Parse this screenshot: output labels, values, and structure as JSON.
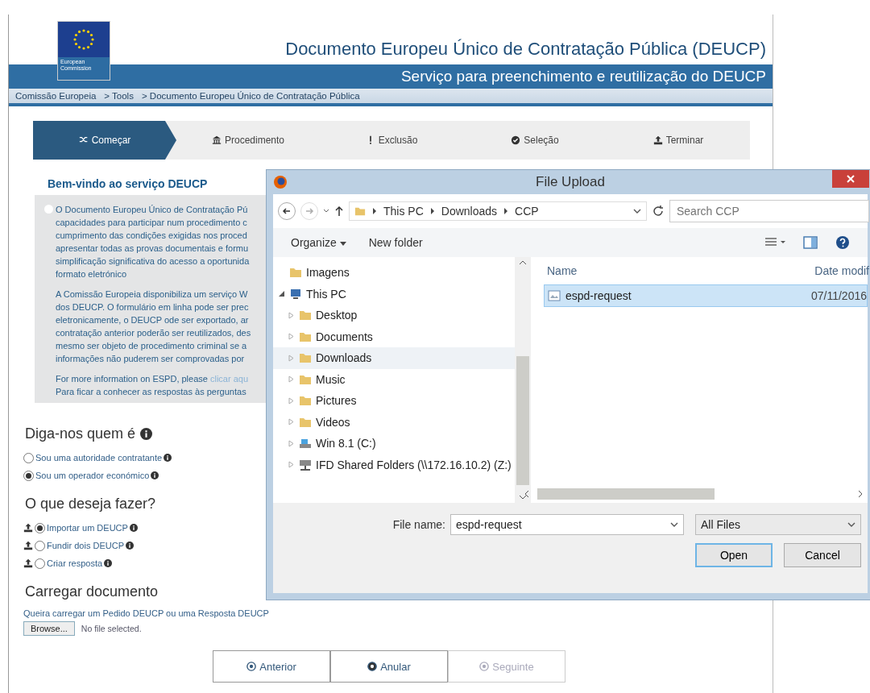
{
  "header": {
    "logo_text": "European Commission",
    "title": "Documento Europeu Único de Contratação Pública (DEUCP)",
    "subtitle": "Serviço para preenchimento e reutilização do DEUCP"
  },
  "breadcrumbs": [
    "Comissão Europeia",
    "> Tools",
    "> Documento Europeu Único de Contratação Pública"
  ],
  "steps": [
    {
      "label": "Começar",
      "selected": true
    },
    {
      "label": "Procedimento",
      "selected": false
    },
    {
      "label": "Exclusão",
      "selected": false
    },
    {
      "label": "Seleção",
      "selected": false
    },
    {
      "label": "Terminar",
      "selected": false
    }
  ],
  "welcome": {
    "heading": "Bem-vindo ao serviço DEUCP",
    "paragraphs": [
      [
        "O Documento Europeu Único de Contratação Pú",
        "capacidades para participar num procedimento c",
        "cumprimento das condições exigidas nos proced",
        "apresentar todas as provas documentais e formu",
        "simplificação significativa do acesso a oportunida",
        "formato eletrónico"
      ],
      [
        "A Comissão Europeia disponibiliza um serviço W",
        "dos DEUCP. O formulário em linha pode ser prec",
        "eletronicamente, o DEUCP ode ser exportado, ar",
        "contratação anterior poderão ser reutilizados, des",
        "mesmo ser objeto de procedimento criminal se a",
        "informações não puderem ser comprovadas por"
      ]
    ],
    "more_info": {
      "text": "For more information on ESPD, please",
      "link": "clicar aqu"
    },
    "last_line": "Para ficar a conhecer as respostas às perguntas"
  },
  "who": {
    "heading": "Diga-nos quem é",
    "options": [
      {
        "label": "Sou uma autoridade contratante",
        "selected": false
      },
      {
        "label": "Sou um operador económico",
        "selected": true
      }
    ]
  },
  "action": {
    "heading": "O que deseja fazer?",
    "options": [
      {
        "label": "Importar um DEUCP",
        "selected": true
      },
      {
        "label": "Fundir dois DEUCP",
        "selected": false
      },
      {
        "label": "Criar resposta",
        "selected": false
      }
    ]
  },
  "upload": {
    "heading": "Carregar documento",
    "hint": "Queira carregar um Pedido DEUCP ou uma Resposta DEUCP",
    "browse_button": "Browse...",
    "file_status": "No file selected."
  },
  "nav_buttons": [
    {
      "label": "Anterior",
      "disabled": false
    },
    {
      "label": "Anular",
      "disabled": false
    },
    {
      "label": "Seguinte",
      "disabled": true
    }
  ],
  "dialog": {
    "title": "File Upload",
    "path": [
      "This PC",
      "Downloads",
      "CCP"
    ],
    "search": {
      "placeholder": "Search CCP"
    },
    "toolbar": [
      "Organize",
      "New folder"
    ],
    "tree": [
      {
        "label": "Imagens",
        "kind": "folder",
        "selected": false
      },
      {
        "label": "This PC",
        "kind": "pc",
        "selected": false,
        "expanded": true,
        "children": [
          {
            "label": "Desktop",
            "kind": "folder",
            "selected": false,
            "expanded": false
          },
          {
            "label": "Documents",
            "kind": "folder",
            "selected": false,
            "expanded": false
          },
          {
            "label": "Downloads",
            "kind": "folder",
            "selected": true,
            "expanded": false
          },
          {
            "label": "Music",
            "kind": "folder",
            "selected": false,
            "expanded": false
          },
          {
            "label": "Pictures",
            "kind": "folder",
            "selected": false,
            "expanded": false
          },
          {
            "label": "Videos",
            "kind": "folder",
            "selected": false,
            "expanded": false
          },
          {
            "label": "Win 8.1 (C:)",
            "kind": "drive",
            "selected": false,
            "expanded": false
          },
          {
            "label": "IFD Shared Folders (\\\\172.16.10.2) (Z:)",
            "kind": "network",
            "selected": false,
            "expanded": false
          }
        ]
      }
    ],
    "columns": [
      "Name",
      "Date modif"
    ],
    "files": [
      {
        "name": "espd-request",
        "date": "07/11/2016",
        "selected": true
      }
    ],
    "file_name_label": "File name:",
    "file_name": "espd-request",
    "file_type": "All Files",
    "buttons": [
      "Open",
      "Cancel"
    ]
  }
}
